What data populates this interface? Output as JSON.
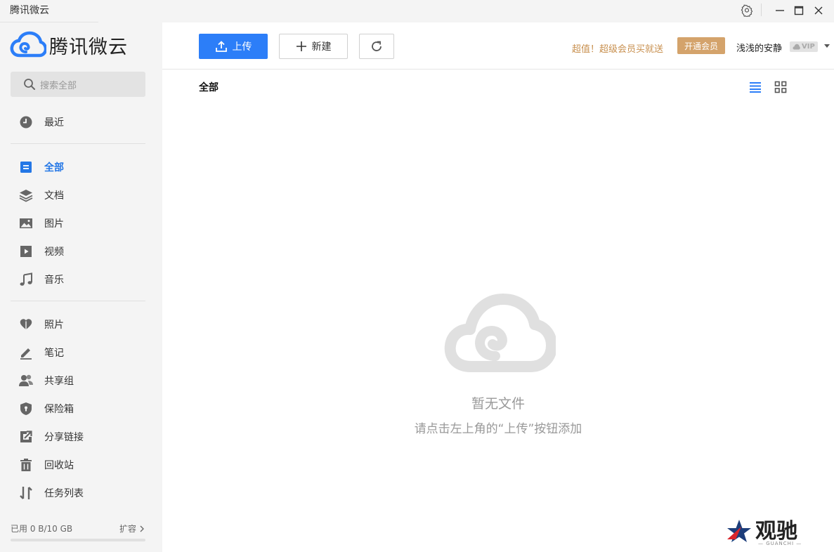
{
  "window": {
    "title": "腾讯微云"
  },
  "brand": {
    "name": "腾讯微云",
    "accent": "#2c7ef8"
  },
  "search": {
    "placeholder": "搜索全部"
  },
  "sidebar": {
    "recent": {
      "label": "最近",
      "icon": "clock-icon"
    },
    "categories": [
      {
        "label": "全部",
        "icon": "all-files-icon",
        "active": true
      },
      {
        "label": "文档",
        "icon": "document-stack-icon"
      },
      {
        "label": "图片",
        "icon": "image-icon"
      },
      {
        "label": "视频",
        "icon": "video-icon"
      },
      {
        "label": "音乐",
        "icon": "music-icon"
      }
    ],
    "tools": [
      {
        "label": "照片",
        "icon": "photos-icon"
      },
      {
        "label": "笔记",
        "icon": "note-icon"
      },
      {
        "label": "共享组",
        "icon": "share-group-icon"
      },
      {
        "label": "保险箱",
        "icon": "safe-box-icon"
      },
      {
        "label": "分享链接",
        "icon": "share-link-icon"
      },
      {
        "label": "回收站",
        "icon": "recycle-bin-icon"
      },
      {
        "label": "任务列表",
        "icon": "task-list-icon"
      }
    ],
    "storage": {
      "used_text": "已用 0 B/10 GB",
      "used_fraction": 0,
      "expand_label": "扩容"
    }
  },
  "toolbar": {
    "upload_label": "上传",
    "new_label": "新建",
    "promo_text": "超值！超级会员买就送",
    "vip_button_label": "开通会员",
    "username": "浅浅的安静",
    "vip_badge": "VIP"
  },
  "content": {
    "breadcrumb": "全部",
    "empty_title": "暂无文件",
    "empty_hint": "请点击左上角的“上传”按钮添加"
  },
  "watermark": {
    "text": "观驰",
    "sub": "— GUANCHI —"
  }
}
